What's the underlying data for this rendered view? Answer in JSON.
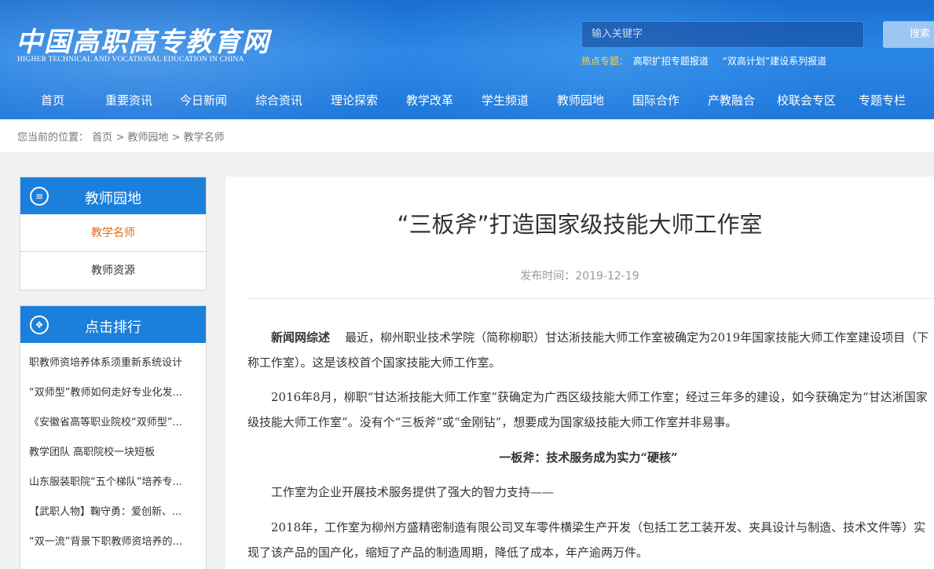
{
  "header": {
    "logo_cn": "中国高职高专教育网",
    "logo_en": "HIGHER TECHNICAL AND VOCATIONAL EDUCATION IN CHINA",
    "search_placeholder": "输入关键字",
    "search_button": "搜索",
    "hot_label": "热点专题：",
    "hot_links": [
      "高职扩招专题报道",
      "“双高计划”建设系列报道"
    ]
  },
  "nav": [
    "首页",
    "重要资讯",
    "今日新闻",
    "综合资讯",
    "理论探索",
    "教学改革",
    "学生频道",
    "教师园地",
    "国际合作",
    "产教融合",
    "校联会专区",
    "专题专栏"
  ],
  "breadcrumb": {
    "prefix": "您当前的位置：",
    "items": [
      "首页",
      "教师园地",
      "教学名师"
    ],
    "separator": ">"
  },
  "sidebar": {
    "section1": {
      "title": "教师园地",
      "links": [
        "教学名师",
        "教师资源"
      ],
      "active": "教学名师"
    },
    "section2": {
      "title": "点击排行",
      "items": [
        "职教师资培养体系须重新系统设计",
        "“双师型”教师如何走好专业化发...",
        "《安徽省高等职业院校“双师型”...",
        "教学团队 高职院校一块短板",
        "山东服装职院“五个梯队”培养专...",
        "【武职人物】鞠守勇：爱创新、...",
        "“双一流”背景下职教师资培养的..."
      ]
    }
  },
  "article": {
    "title": "“三板斧”打造国家级技能大师工作室",
    "pub_label": "发布时间：",
    "pub_date": "2019-12-19",
    "p1_lead": "新闻网综述",
    "p1_text": "最近，柳州职业技术学院（简称柳职）甘达淅技能大师工作室被确定为2019年国家技能大师工作室建设项目（下称工作室）。这是该校首个国家技能大师工作室。",
    "p2_text": "2016年8月，柳职“甘达淅技能大师工作室”获确定为广西区级技能大师工作室；经过三年多的建设，如今获确定为“甘达淅国家级技能大师工作室”。没有个“三板斧”或“金刚钻”，想要成为国家级技能大师工作室并非易事。",
    "subhead": "一板斧：技术服务成为实力“硬核”",
    "p3_text": "工作室为企业开展技术服务提供了强大的智力支持——",
    "p4_text": "2018年，工作室为柳州方盛精密制造有限公司叉车零件横梁生产开发（包括工艺工装开发、夹具设计与制造、技术文件等）实现了该产品的国产化，缩短了产品的制造周期，降低了成本，年产逾两万件。"
  }
}
